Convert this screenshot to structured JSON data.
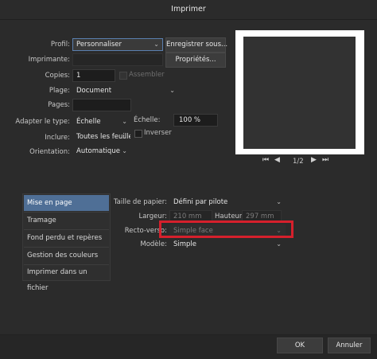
{
  "window": {
    "title": "Imprimer"
  },
  "form": {
    "profil": {
      "label": "Profil:",
      "value": "Personnaliser",
      "save_button": "Enregistrer sous..."
    },
    "imprimante": {
      "label": "Imprimante:",
      "value": "",
      "properties_button": "Propriétés..."
    },
    "copies": {
      "label": "Copies:",
      "value": "1",
      "assembler_label": "Assembler"
    },
    "plage": {
      "label": "Plage:",
      "value": "Document"
    },
    "pages": {
      "label": "Pages:",
      "value": ""
    },
    "adapter": {
      "label": "Adapter le type:",
      "value": "Échelle"
    },
    "echelle": {
      "label": "Échelle:",
      "value": "100 %"
    },
    "inclure": {
      "label": "Inclure:",
      "value": "Toutes les feuilles",
      "inverser_label": "Inverser"
    },
    "orientation": {
      "label": "Orientation:",
      "value": "Automatique"
    }
  },
  "preview": {
    "page_indicator": "1/2",
    "first_icon": "first-page-icon",
    "prev_icon": "prev-page-icon",
    "next_icon": "next-page-icon",
    "last_icon": "last-page-icon"
  },
  "sidebar": {
    "items": [
      {
        "label": "Mise en page",
        "active": true
      },
      {
        "label": "Tramage",
        "active": false
      },
      {
        "label": "Fond perdu et repères",
        "active": false
      },
      {
        "label": "Gestion des couleurs",
        "active": false
      },
      {
        "label": "Imprimer dans un fichier",
        "active": false
      }
    ]
  },
  "layout_panel": {
    "taille": {
      "label": "Taille de papier:",
      "value": "Défini par pilote"
    },
    "largeur": {
      "label": "Largeur:",
      "value": "210 mm"
    },
    "hauteur": {
      "label": "Hauteur:",
      "value": "297 mm"
    },
    "recto": {
      "label": "Recto-verso:",
      "value": "Simple face"
    },
    "modele": {
      "label": "Modèle:",
      "value": "Simple"
    }
  },
  "footer": {
    "ok_label": "OK",
    "cancel_label": "Annuler"
  },
  "colors": {
    "accent": "#4f6f96",
    "highlight": "#d6202c"
  }
}
